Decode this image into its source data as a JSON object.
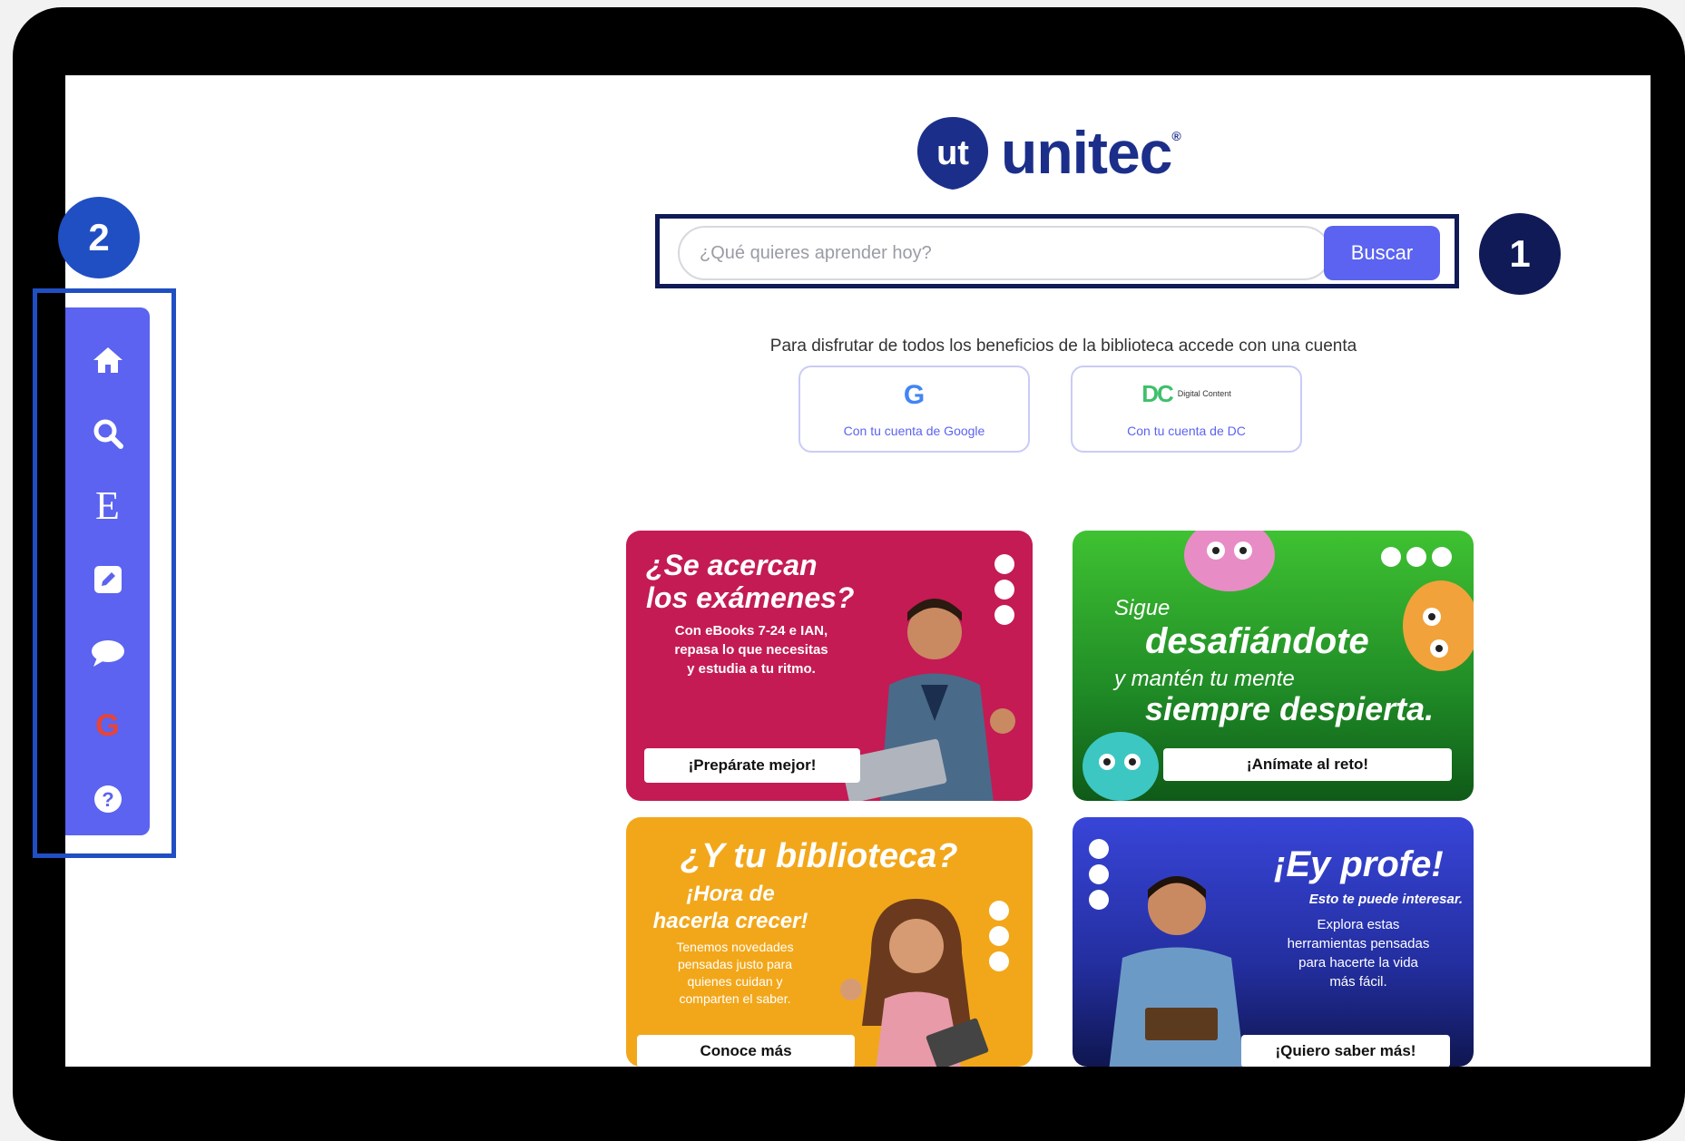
{
  "logo": {
    "badge": "ut",
    "name": "unitec"
  },
  "search": {
    "placeholder": "¿Qué quieres aprender hoy?",
    "button_label": "Buscar"
  },
  "login": {
    "prompt": "Para disfrutar de todos los beneficios de la biblioteca accede con una cuenta",
    "google_label": "Con tu cuenta de Google",
    "dc_label": "Con tu cuenta de DC",
    "dc_small": "Digital Content"
  },
  "sidebar": {
    "items": [
      {
        "icon": "home-icon"
      },
      {
        "icon": "search-icon"
      },
      {
        "icon": "e-icon",
        "glyph": "E"
      },
      {
        "icon": "edit-icon"
      },
      {
        "icon": "chat-icon"
      },
      {
        "icon": "google-icon",
        "glyph": "G"
      },
      {
        "icon": "help-icon"
      }
    ]
  },
  "cards": [
    {
      "title_1": "¿Se acercan",
      "title_2": "los exámenes?",
      "body_1": "Con eBooks 7-24 e IAN,",
      "body_2": "repasa lo que necesitas",
      "body_3": "y estudia a tu ritmo.",
      "cta": "¡Prepárate mejor!",
      "color": "#c41b54"
    },
    {
      "line_1": "Sigue",
      "line_2": "desafiándote",
      "line_3": "y mantén tu mente",
      "line_4": "siempre despierta.",
      "cta": "¡Anímate al reto!",
      "color": "#2ea82b"
    },
    {
      "title_1": "¿Y tu biblioteca?",
      "title_2": "¡Hora de",
      "title_3": "hacerla crecer!",
      "body_1": "Tenemos novedades",
      "body_2": "pensadas justo para",
      "body_3": "quienes cuidan y",
      "body_4": "comparten el saber.",
      "cta": "Conoce más",
      "color": "#f2a71a"
    },
    {
      "title_1": "¡Ey profe!",
      "subtitle": "Esto te puede interesar.",
      "body_1": "Explora estas",
      "body_2": "herramientas pensadas",
      "body_3": "para hacerte la vida",
      "body_4": "más fácil.",
      "cta": "¡Quiero saber más!",
      "color": "#2a36b8"
    }
  ],
  "annotations": {
    "n1": "1",
    "n2": "2"
  },
  "colors": {
    "accent": "#5b63f0",
    "brand_dark": "#1b2f8a",
    "annotation_1": "#0f1a57",
    "annotation_2": "#1f4fc2"
  }
}
